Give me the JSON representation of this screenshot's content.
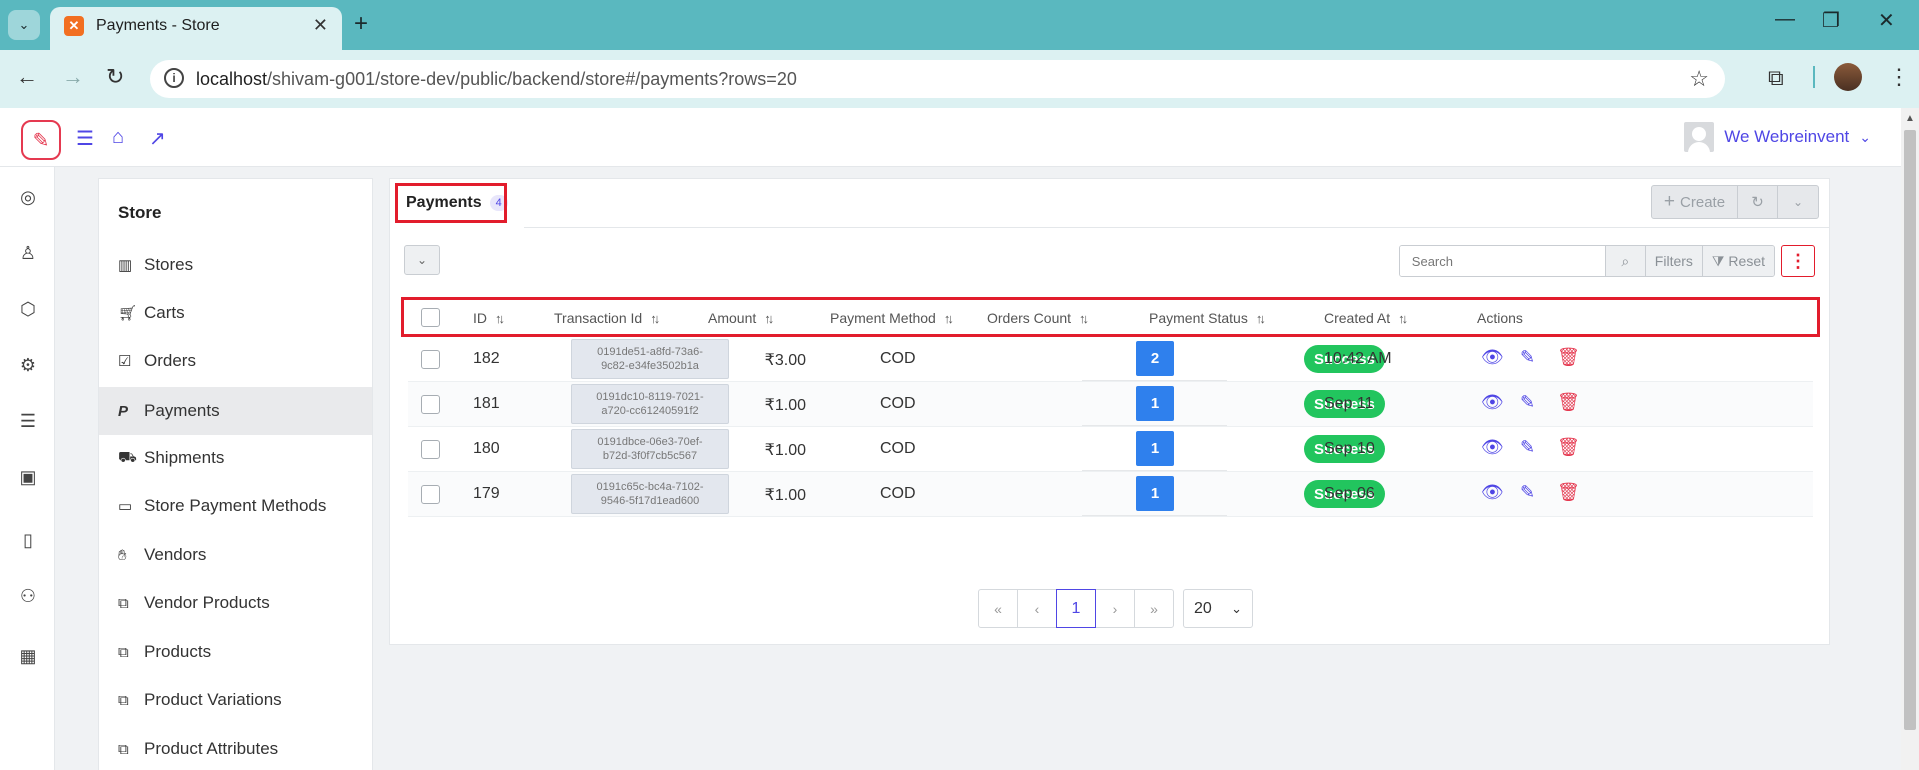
{
  "browser": {
    "tab_title": "Payments - Store",
    "url_host": "localhost",
    "url_path": "/shivam-g001/store-dev/public/backend/store#/payments?rows=20"
  },
  "header": {
    "user_name": "We Webreinvent"
  },
  "sidebar": {
    "title": "Store",
    "items": [
      {
        "label": "Stores",
        "icon": "building-icon"
      },
      {
        "label": "Carts",
        "icon": "cart-icon"
      },
      {
        "label": "Orders",
        "icon": "checkbox-icon"
      },
      {
        "label": "Payments",
        "icon": "paypal-icon"
      },
      {
        "label": "Shipments",
        "icon": "truck-icon"
      },
      {
        "label": "Store Payment Methods",
        "icon": "credit-card-icon"
      },
      {
        "label": "Vendors",
        "icon": "handshake-icon"
      },
      {
        "label": "Vendor Products",
        "icon": "copy-icon"
      },
      {
        "label": "Products",
        "icon": "copy-icon"
      },
      {
        "label": "Product Variations",
        "icon": "copy-icon"
      },
      {
        "label": "Product Attributes",
        "icon": "copy-icon"
      }
    ]
  },
  "panel": {
    "tab_label": "Payments",
    "tab_count": "4",
    "create_label": "Create",
    "search_placeholder": "Search",
    "filters_label": "Filters",
    "reset_label": "Reset"
  },
  "table": {
    "headers": [
      "ID",
      "Transaction Id",
      "Amount",
      "Payment Method",
      "Orders Count",
      "Payment Status",
      "Created At",
      "Actions"
    ],
    "rows": [
      {
        "id": "182",
        "txn_line1": "0191de51-a8fd-73a6-",
        "txn_line2": "9c82-e34fe3502b1a",
        "amount": "₹3.00",
        "method": "COD",
        "orders": "2",
        "status": "Success",
        "created": "10:42 AM"
      },
      {
        "id": "181",
        "txn_line1": "0191dc10-8119-7021-",
        "txn_line2": "a720-cc61240591f2",
        "amount": "₹1.00",
        "method": "COD",
        "orders": "1",
        "status": "Success",
        "created": "Sep 11"
      },
      {
        "id": "180",
        "txn_line1": "0191dbce-06e3-70ef-",
        "txn_line2": "b72d-3f0f7cb5c567",
        "amount": "₹1.00",
        "method": "COD",
        "orders": "1",
        "status": "Success",
        "created": "Sep 10"
      },
      {
        "id": "179",
        "txn_line1": "0191c65c-bc4a-7102-",
        "txn_line2": "9546-5f17d1ead600",
        "amount": "₹1.00",
        "method": "COD",
        "orders": "1",
        "status": "Success",
        "created": "Sep 06"
      }
    ]
  },
  "pagination": {
    "current_page": "1",
    "rows_per_page": "20"
  },
  "colors": {
    "accent": "#4f46e5",
    "danger": "#e53950",
    "success": "#22c55e",
    "count_badge": "#2f80ed",
    "browser_frame": "#5ab8bf"
  }
}
